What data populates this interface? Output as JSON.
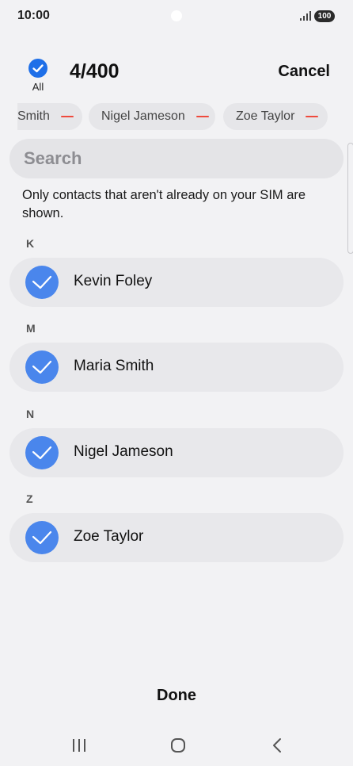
{
  "status_bar": {
    "time": "10:00",
    "battery": "100"
  },
  "header": {
    "all_label": "All",
    "count": "4/400",
    "cancel_label": "Cancel"
  },
  "chips": [
    {
      "label": "Maria Smith",
      "visible_text": "Smith"
    },
    {
      "label": "Nigel Jameson"
    },
    {
      "label": "Zoe Taylor"
    }
  ],
  "search": {
    "placeholder": "Search"
  },
  "notice": "Only contacts that aren't already on your SIM are shown.",
  "sections": [
    {
      "letter": "K",
      "contact": "Kevin Foley"
    },
    {
      "letter": "M",
      "contact": "Maria Smith"
    },
    {
      "letter": "N",
      "contact": "Nigel Jameson"
    },
    {
      "letter": "Z",
      "contact": "Zoe Taylor"
    }
  ],
  "footer": {
    "done_label": "Done"
  },
  "colors": {
    "accent": "#1e6fe8",
    "check": "#4a86ec",
    "remove": "#ef4a3d",
    "background": "#f2f2f4"
  }
}
